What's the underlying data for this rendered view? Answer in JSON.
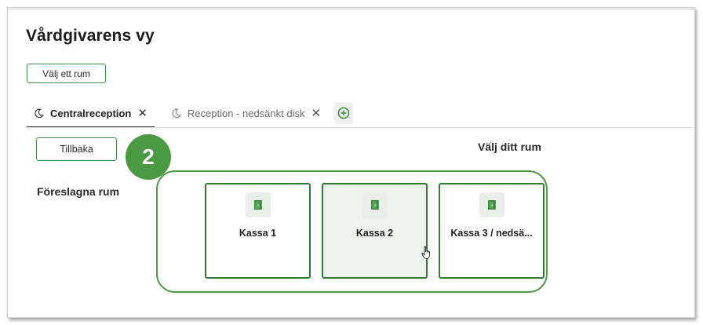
{
  "page": {
    "title": "Vårdgivarens vy"
  },
  "toolbar": {
    "pick_room_label": "Välj ett rum"
  },
  "tabs": [
    {
      "label": "Centralreception",
      "icon": "moon-icon",
      "active": true
    },
    {
      "label": "Reception - nedsänkt disk",
      "icon": "moon-icon",
      "active": false
    }
  ],
  "add_tab_icon": "plus-circle-icon",
  "back_label": "Tillbaka",
  "step_badge": "2",
  "section_title": "Välj ditt rum",
  "suggested_label": "Föreslagna rum",
  "rooms": [
    {
      "label": "Kassa 1",
      "icon": "door-icon"
    },
    {
      "label": "Kassa 2",
      "icon": "door-icon",
      "hovered": true
    },
    {
      "label": "Kassa 3 / nedsä...",
      "icon": "door-icon"
    }
  ],
  "colors": {
    "accent": "#2f7a36",
    "badge": "#4a9a44",
    "ring": "#4f9c48",
    "icon": "#3c8a3c"
  }
}
